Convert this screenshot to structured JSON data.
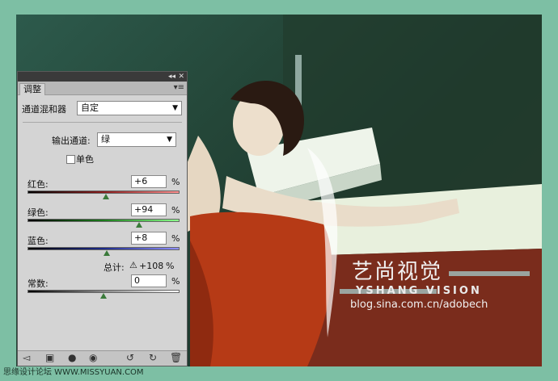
{
  "watermark": {
    "cn": "艺尚视觉",
    "en": "YSHANG VISION",
    "url": "blog.sina.com.cn/adobech"
  },
  "footer": {
    "left": "思缘设计论坛 WWW.MISSYUAN.COM"
  },
  "panel": {
    "tab": "调整",
    "title_buttons": [
      "◂◂",
      "✕"
    ],
    "menu_icon": "▾≡",
    "mixer_label": "通道混和器",
    "preset_value": "自定",
    "output_channel_label": "输出通道:",
    "output_channel_value": "绿",
    "monochrome_label": "单色",
    "sliders": [
      {
        "label": "红色:",
        "value": "+6",
        "unit": "%",
        "level": 6
      },
      {
        "label": "绿色:",
        "value": "+94",
        "unit": "%",
        "level": 94
      },
      {
        "label": "蓝色:",
        "value": "+8",
        "unit": "%",
        "level": 8
      }
    ],
    "total_label": "总计:",
    "total_warning_icon": "⚠",
    "total_value": "+108",
    "total_unit": "%",
    "constant_label": "常数:",
    "constant_value": "0",
    "constant_unit": "%",
    "constant_level": 0,
    "bottom_icons": [
      "◅",
      "▣",
      "●",
      "◉",
      "↺",
      "↻",
      "🗑"
    ]
  },
  "colors": {
    "background": "#7dbfa4",
    "dress": "#b63a16",
    "counter": "#e9f1df"
  }
}
